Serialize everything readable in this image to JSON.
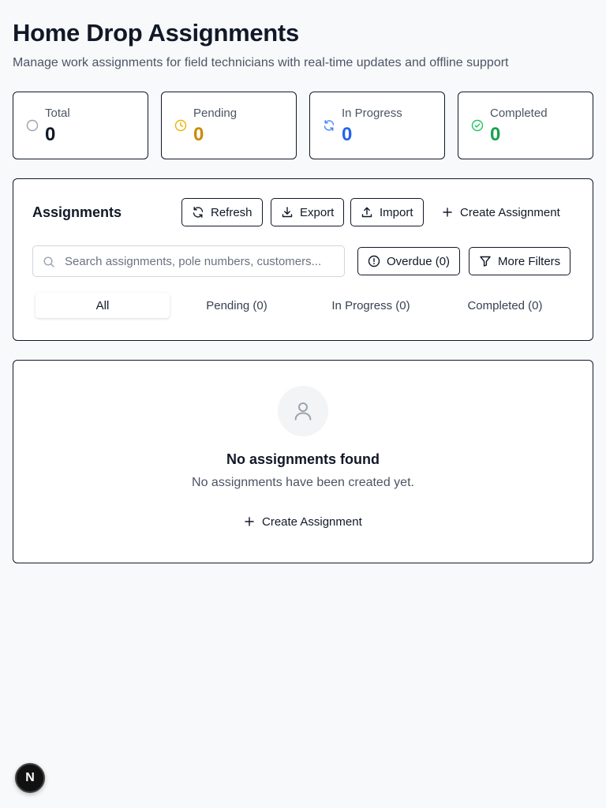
{
  "page": {
    "title": "Home Drop Assignments",
    "subtitle": "Manage work assignments for field technicians with real-time updates and offline support"
  },
  "stats": [
    {
      "label": "Total",
      "value": "0",
      "icon": "circle-icon",
      "color": "#111827",
      "icon_color": "#9ca3af"
    },
    {
      "label": "Pending",
      "value": "0",
      "icon": "clock-icon",
      "color": "#ca8a04",
      "icon_color": "#eab308"
    },
    {
      "label": "In Progress",
      "value": "0",
      "icon": "refresh-icon",
      "color": "#2563eb",
      "icon_color": "#3b82f6"
    },
    {
      "label": "Completed",
      "value": "0",
      "icon": "check-circle-icon",
      "color": "#16a34a",
      "icon_color": "#22c55e"
    }
  ],
  "assignments_panel": {
    "title": "Assignments",
    "refresh_label": "Refresh",
    "export_label": "Export",
    "import_label": "Import",
    "create_label": "Create Assignment",
    "search_placeholder": "Search assignments, pole numbers, customers...",
    "overdue_label": "Overdue (0)",
    "more_filters_label": "More Filters",
    "tabs": [
      {
        "label": "All",
        "active": true
      },
      {
        "label": "Pending (0)",
        "active": false
      },
      {
        "label": "In Progress (0)",
        "active": false
      },
      {
        "label": "Completed (0)",
        "active": false
      }
    ]
  },
  "empty_state": {
    "icon": "user-icon",
    "title": "No assignments found",
    "description": "No assignments have been created yet.",
    "cta_label": "Create Assignment"
  },
  "dev_badge": {
    "letter": "N"
  }
}
